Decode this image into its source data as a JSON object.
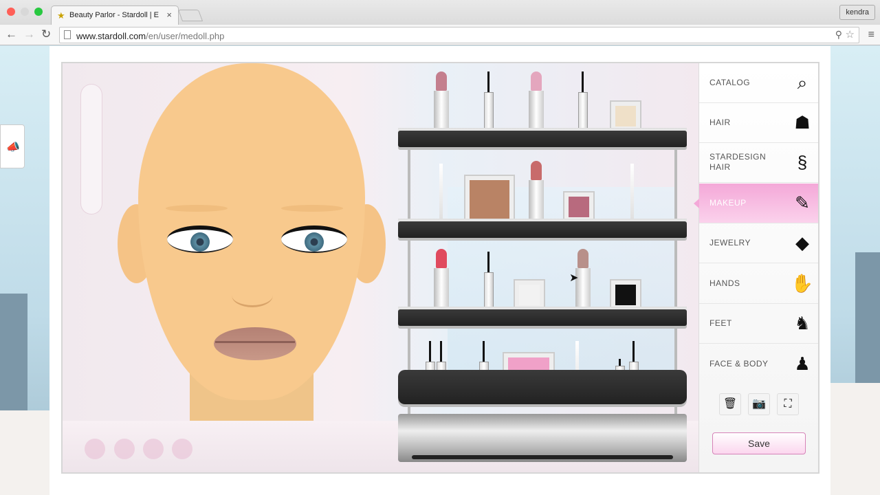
{
  "browser": {
    "tab_title": "Beauty Parlor - Stardoll | E",
    "tab_close": "×",
    "user": "kendra",
    "url_host": "www.stardoll.com",
    "url_path": "/en/user/medoll.php",
    "back": "←",
    "forward": "→",
    "reload": "↻",
    "zoom_icon": "zoom-icon",
    "star_icon": "bookmark-star-icon",
    "menu_icon": "hamburger-menu-icon",
    "traffic_colors": [
      "#ff5f57",
      "#d8d8d8",
      "#28c840"
    ]
  },
  "menu": {
    "items": [
      {
        "label": "CATALOG",
        "icon": "magnifier-catalog-icon",
        "glyph": "⌕"
      },
      {
        "label": "HAIR",
        "icon": "hair-icon",
        "glyph": "☗"
      },
      {
        "label": "STARDESIGN HAIR",
        "icon": "stardesign-hair-icon",
        "glyph": "§"
      },
      {
        "label": "MAKEUP",
        "icon": "makeup-icon",
        "glyph": "✎"
      },
      {
        "label": "JEWELRY",
        "icon": "jewelry-icon",
        "glyph": "◆"
      },
      {
        "label": "HANDS",
        "icon": "hand-icon",
        "glyph": "✋"
      },
      {
        "label": "FEET",
        "icon": "foot-icon",
        "glyph": "♞"
      },
      {
        "label": "FACE & BODY",
        "icon": "face-body-icon",
        "glyph": "♟"
      }
    ],
    "active": "MAKEUP",
    "accent": "#f4a8d8",
    "save_label": "Save",
    "controls": [
      {
        "name": "trash-icon",
        "glyph": "🗑"
      },
      {
        "name": "camera-icon",
        "glyph": "📷"
      },
      {
        "name": "fullscreen-icon",
        "glyph": "⛶"
      }
    ]
  }
}
